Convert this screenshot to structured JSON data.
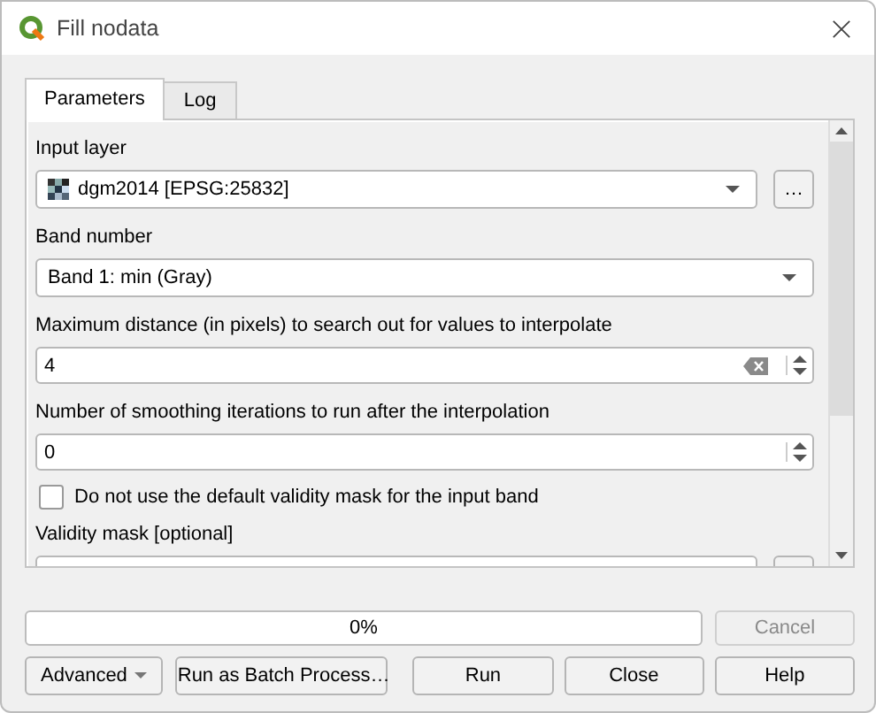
{
  "window": {
    "title": "Fill nodata"
  },
  "tabs": [
    {
      "label": "Parameters",
      "selected": true
    },
    {
      "label": "Log",
      "selected": false
    }
  ],
  "parameters": [
    {
      "kind": "layer",
      "label": "Input layer",
      "value": "dgm2014 [EPSG:25832]",
      "button": "…"
    },
    {
      "kind": "combo",
      "label": "Band number",
      "value": "Band 1: min (Gray)"
    },
    {
      "kind": "spin",
      "label": "Maximum distance (in pixels) to search out for values to interpolate",
      "value": "4",
      "clearable": true
    },
    {
      "kind": "spin",
      "label": "Number of smoothing iterations to run after the interpolation",
      "value": "0",
      "clearable": false
    },
    {
      "kind": "checkbox",
      "label": "Do not use the default validity mask for the input band",
      "checked": false
    },
    {
      "kind": "layer",
      "label": "Validity mask [optional]"
    }
  ],
  "progress": {
    "level": 0,
    "text": "0%"
  },
  "cancel_button": {
    "label": "Cancel",
    "disabled": true
  },
  "buttons": [
    {
      "kind": "menu",
      "label": "Advanced"
    },
    {
      "kind": "push",
      "label": "Run as Batch Process…"
    },
    {
      "kind": "push",
      "label": "Run"
    },
    {
      "kind": "push",
      "label": "Close"
    },
    {
      "kind": "push",
      "label": "Help"
    }
  ]
}
